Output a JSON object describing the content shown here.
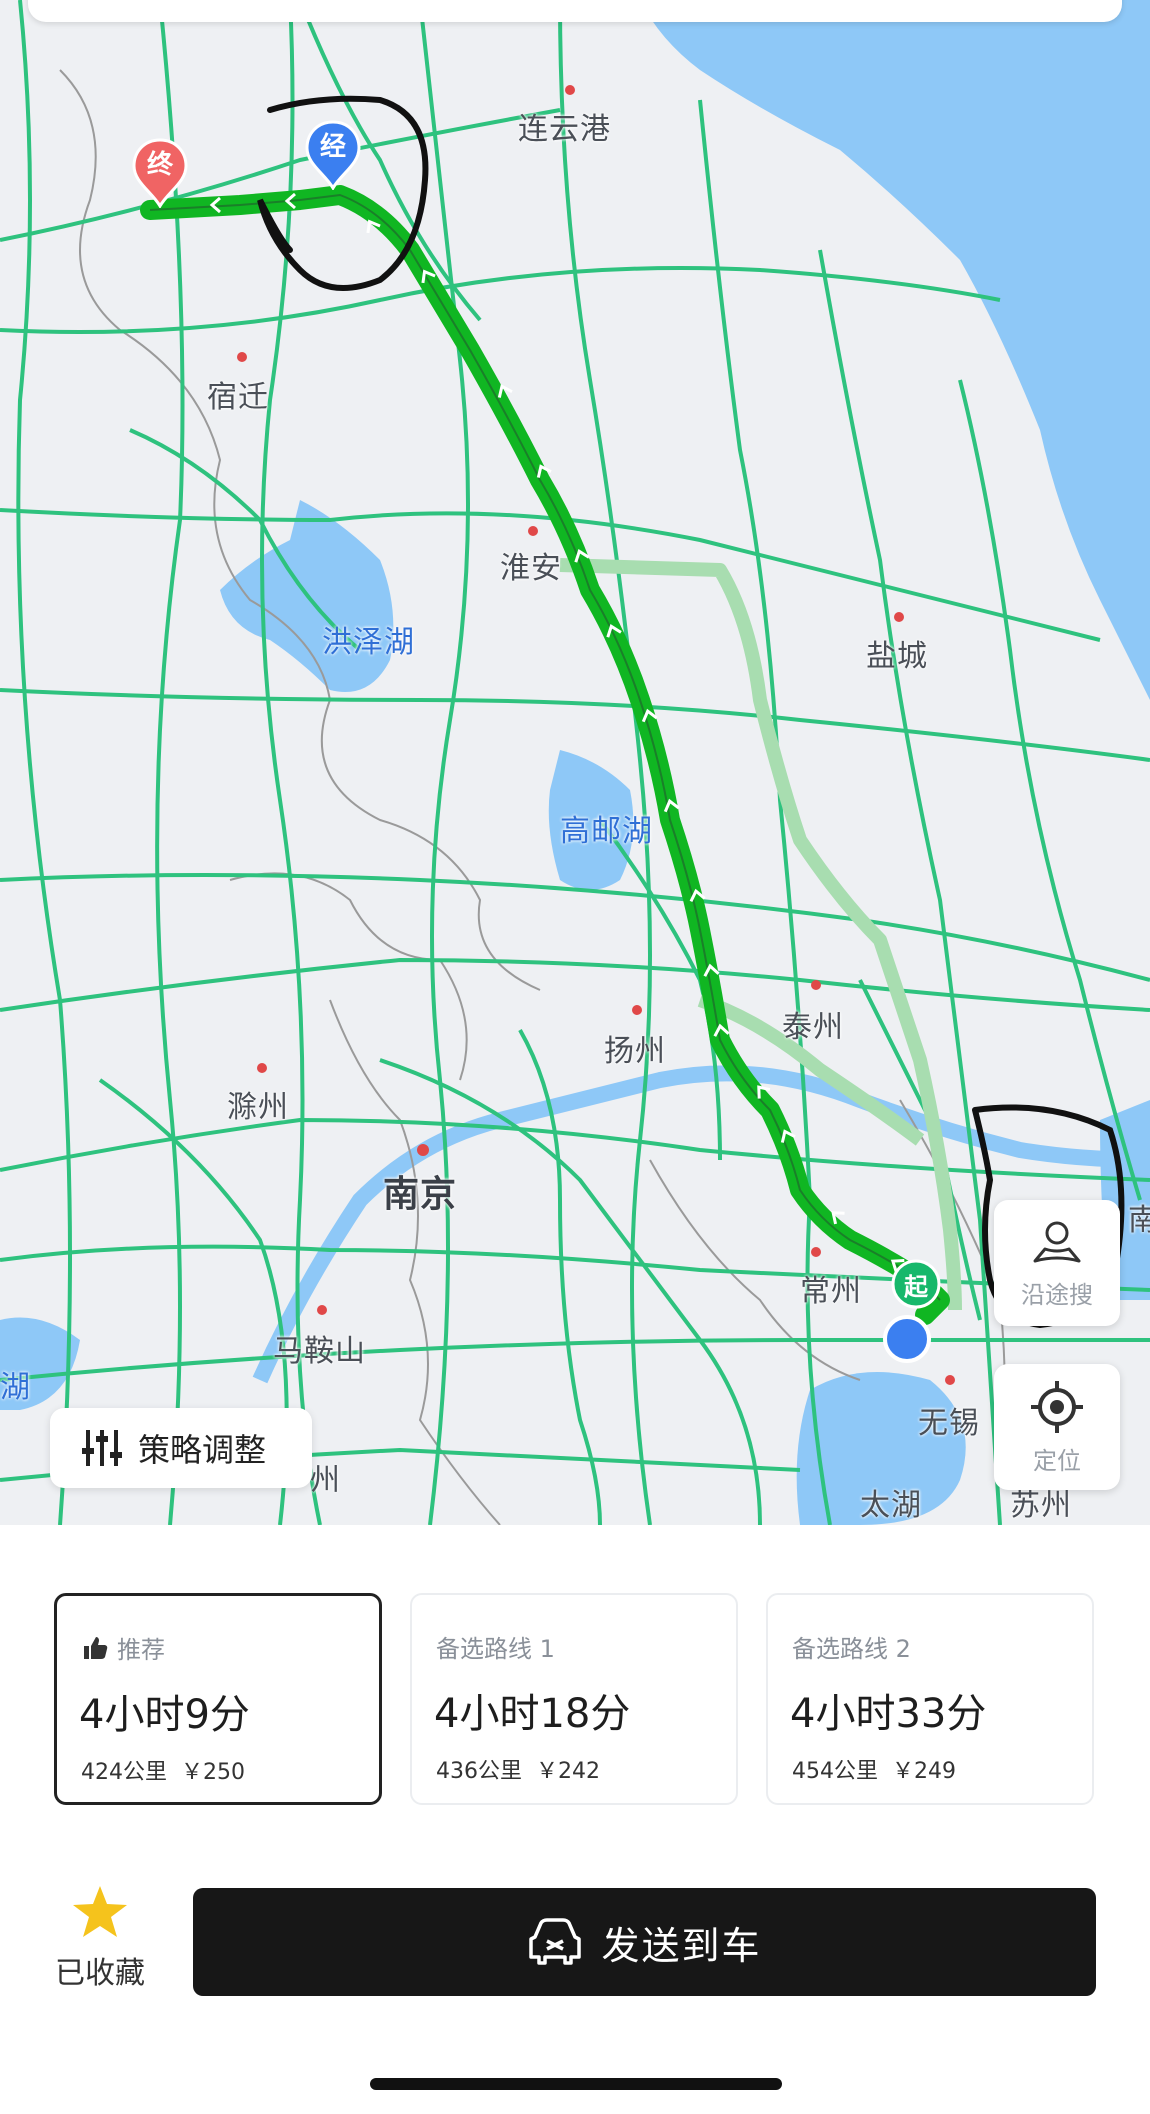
{
  "map": {
    "cities": [
      {
        "id": "lianyungang",
        "label": "连云港"
      },
      {
        "id": "suqian",
        "label": "宿迁"
      },
      {
        "id": "huaian",
        "label": "淮安"
      },
      {
        "id": "hongzehu",
        "label": "洪泽湖"
      },
      {
        "id": "yancheng",
        "label": "盐城"
      },
      {
        "id": "gaoyouhu",
        "label": "高邮湖"
      },
      {
        "id": "taizhou",
        "label": "泰州"
      },
      {
        "id": "yangzhou",
        "label": "扬州"
      },
      {
        "id": "chuzhou",
        "label": "滁州"
      },
      {
        "id": "nanjing",
        "label": "南京"
      },
      {
        "id": "changzhou",
        "label": "常州"
      },
      {
        "id": "maanshan",
        "label": "马鞍山"
      },
      {
        "id": "wuxi",
        "label": "无锡"
      },
      {
        "id": "taihu",
        "label": "太湖"
      },
      {
        "id": "hu_left",
        "label": "湖"
      },
      {
        "id": "nan_right",
        "label": "南"
      },
      {
        "id": "zhou_frag",
        "label": "州"
      },
      {
        "id": "su_frag",
        "label": "苏州"
      }
    ],
    "markers": {
      "end": "终",
      "via": "经",
      "start": "起"
    },
    "buttons": {
      "along_search": "沿途搜",
      "locate": "定位",
      "strategy": "策略调整"
    },
    "colors": {
      "route_main": "#10b622",
      "route_alt": "#a8ddb0",
      "water": "#8ec8f7",
      "highway": "#2ec27e"
    }
  },
  "routes": [
    {
      "tag": "推荐",
      "time": "4小时9分",
      "distance": "424公里",
      "toll": "￥250",
      "selected": true
    },
    {
      "tag": "备选路线 1",
      "time": "4小时18分",
      "distance": "436公里",
      "toll": "￥242",
      "selected": false
    },
    {
      "tag": "备选路线 2",
      "time": "4小时33分",
      "distance": "454公里",
      "toll": "￥249",
      "selected": false
    }
  ],
  "actions": {
    "favorite": "已收藏",
    "send": "发送到车"
  }
}
